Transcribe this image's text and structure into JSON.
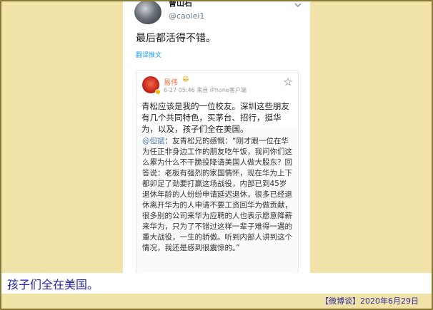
{
  "tweet": {
    "display_name": "曹山石",
    "handle": "@caolei1",
    "text": "最后都活得不错。",
    "translate_label": "翻译推文"
  },
  "weibo": {
    "author": "易伟",
    "author_emoji": "😁",
    "meta": "6-27 05:46  来自 iPhone客户端",
    "text": "青松应该是我的一位校友。深圳这些朋友有几个共同特色，买茅台、招行，挺华为，以及，孩子们全在美国。",
    "repost_mention": "@但斌",
    "repost_text": "：友青松兄的感慨：“刚才跟一位在华为任正非身边工作的朋友吃午饭，我问你们这么累为什么不干脆投降请美国人做大股东？回答说：老板有强烈的家国情怀，现在华为上下都卯足了劲要打赢这场战役，内部已到45岁退休年龄的人纷纷申请延迟退休，很多已经退休离开华为的人申请不要工资回华为做贡献，很多别的公司来华为应聘的人也表示愿意降薪来华为，只为了不错过这样一辈子难得一遇的重大战役，一生的骄傲。听到内部人讲到这个情况，我还是感到很震惊的。”"
  },
  "caption": "孩子们全在美国。",
  "footer": "【微博谈】2020年6月29日",
  "colors": {
    "page_background": "#f1e2a7",
    "caption_text": "#2323a8",
    "twitter_link": "#1da1f2",
    "weibo_name": "#eb7340",
    "weibo_mention": "#507daf"
  }
}
